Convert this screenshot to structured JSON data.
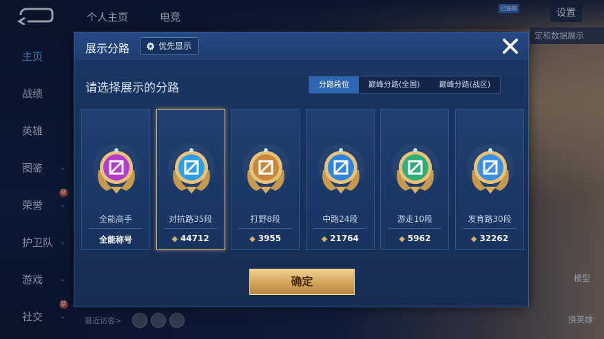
{
  "background": {
    "tabs": [
      "个人主页",
      "电竞"
    ],
    "settings_label": "设置",
    "badge_text": "已获取",
    "side_notice": "定和数据展示",
    "visitors_label": "最近访客>",
    "right_buttons": [
      "模型",
      "换英雄"
    ]
  },
  "sidebar": {
    "items": [
      {
        "label": "主页",
        "active": true
      },
      {
        "label": "战绩"
      },
      {
        "label": "英雄"
      },
      {
        "label": "图鉴",
        "chevron": true
      },
      {
        "label": "荣誉",
        "chevron": true,
        "new": "新"
      },
      {
        "label": "护卫队",
        "chevron": true
      },
      {
        "label": "游戏",
        "chevron": true
      },
      {
        "label": "社交",
        "chevron": true,
        "new": "新"
      }
    ]
  },
  "modal": {
    "title": "展示分路",
    "priority_label": "优先显示",
    "subtitle": "请选择展示的分路",
    "segments": [
      {
        "label": "分路段位",
        "active": true
      },
      {
        "label": "巅峰分路(全国)"
      },
      {
        "label": "巅峰分路(战区)"
      }
    ],
    "cards": [
      {
        "name": "全能高手",
        "value": "全能称号",
        "color": "#b43ccf",
        "selected": false,
        "gem": false
      },
      {
        "name": "对抗路35段",
        "value": "44712",
        "color": "#2f9ee8",
        "selected": true,
        "gem": true
      },
      {
        "name": "打野8段",
        "value": "3955",
        "color": "#c88a3a",
        "selected": false,
        "gem": true
      },
      {
        "name": "中路24段",
        "value": "21764",
        "color": "#2f86e0",
        "selected": false,
        "gem": true
      },
      {
        "name": "游走10段",
        "value": "5962",
        "color": "#2fae7a",
        "selected": false,
        "gem": true
      },
      {
        "name": "发育路30段",
        "value": "32262",
        "color": "#3a8fe6",
        "selected": false,
        "gem": true
      }
    ],
    "confirm_label": "确定"
  },
  "colors": {
    "accent_blue": "#2e67b4",
    "gold": "#e2b86a",
    "modal_bg": "#1c3766"
  }
}
